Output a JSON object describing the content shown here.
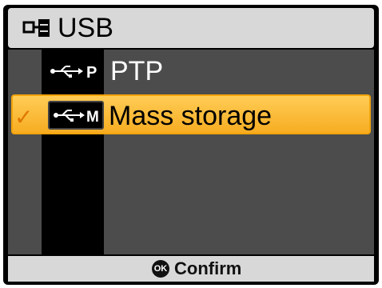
{
  "header": {
    "title": "USB",
    "icon": "usb-settings-icon"
  },
  "items": [
    {
      "label": "PTP",
      "icon_letter": "P",
      "icon": "usb-ptp-icon",
      "selected": false
    },
    {
      "label": "Mass storage",
      "icon_letter": "M",
      "icon": "usb-mass-storage-icon",
      "selected": true
    }
  ],
  "footer": {
    "ok_label": "OK",
    "confirm_label": "Confirm"
  },
  "colors": {
    "highlight": "#f7ad22",
    "highlight_border": "#f2a40a",
    "checkmark": "#e07700",
    "panel": "#4c4c4c",
    "header_bg": "#d8d8d8"
  }
}
